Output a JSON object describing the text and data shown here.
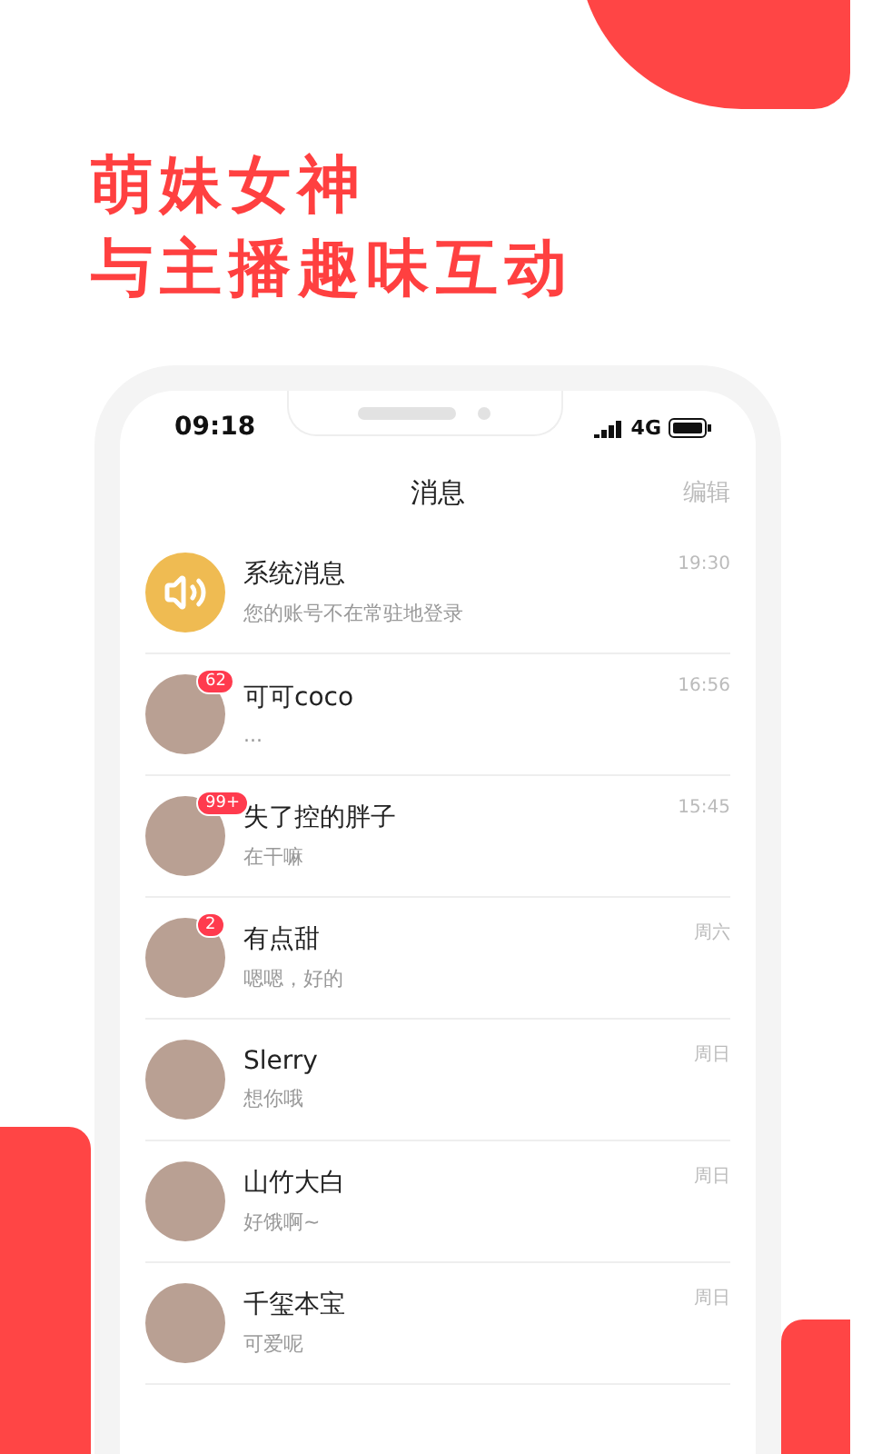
{
  "headline": [
    "萌妹女神",
    "与主播趣味互动"
  ],
  "status_bar": {
    "time": "09:18",
    "network": "4G"
  },
  "header": {
    "title": "消息",
    "action": "编辑"
  },
  "messages": [
    {
      "kind": "system",
      "name": "系统消息",
      "preview": "您的账号不在常驻地登录",
      "time": "19:30"
    },
    {
      "kind": "user",
      "name": "可可coco",
      "preview": "...",
      "time": "16:56",
      "badge": "62"
    },
    {
      "kind": "user",
      "name": "失了控的胖子",
      "preview": "在干嘛",
      "time": "15:45",
      "badge": "99+"
    },
    {
      "kind": "user",
      "name": "有点甜",
      "preview": "嗯嗯，好的",
      "time": "周六",
      "badge": "2"
    },
    {
      "kind": "user",
      "name": "Slerry",
      "preview": "想你哦",
      "time": "周日"
    },
    {
      "kind": "user",
      "name": "山竹大白",
      "preview": "好饿啊~",
      "time": "周日"
    },
    {
      "kind": "user",
      "name": "千玺本宝",
      "preview": "可爱呢",
      "time": "周日"
    }
  ]
}
